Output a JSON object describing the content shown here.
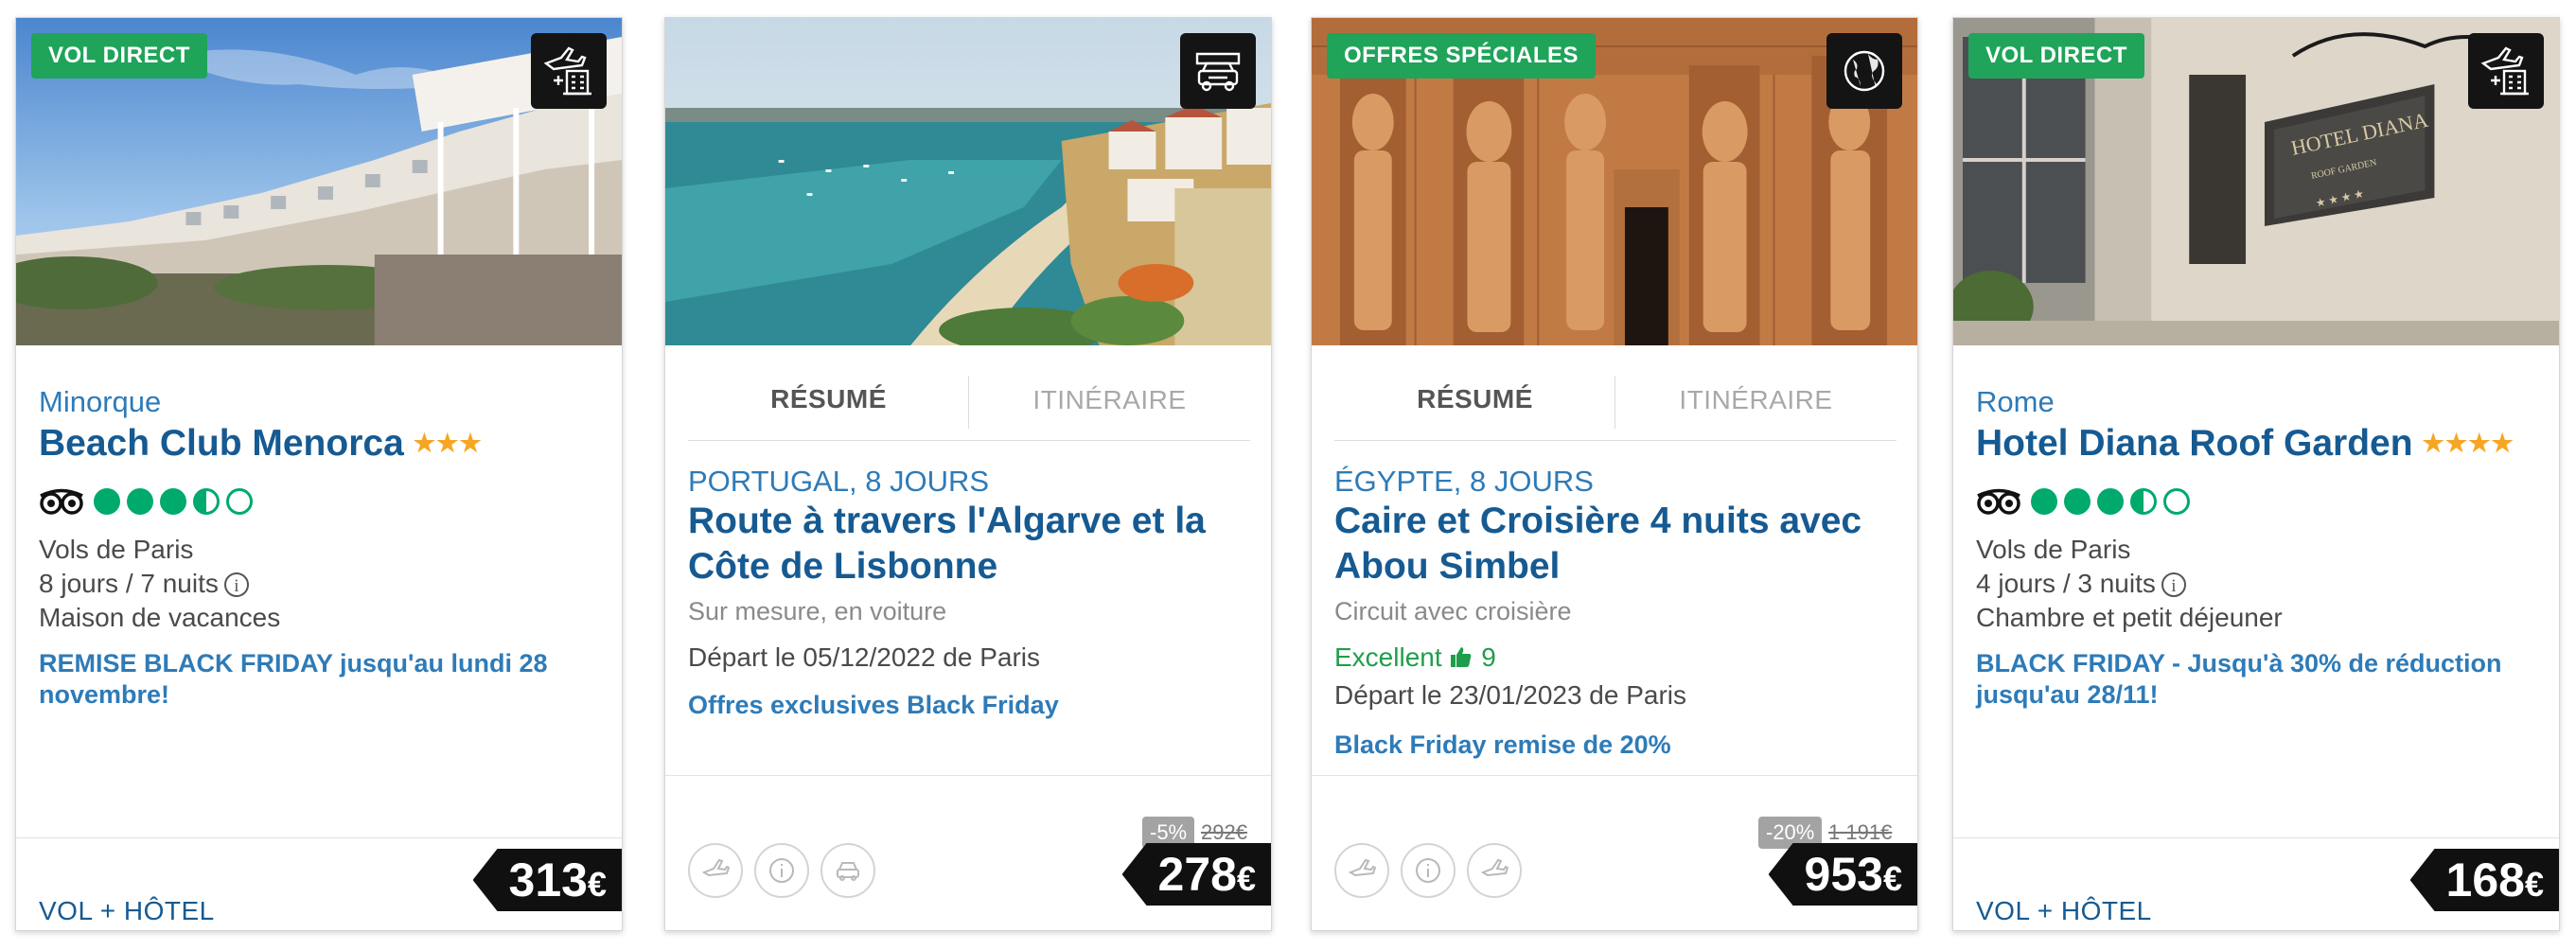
{
  "cards": [
    {
      "badge": "VOL DIRECT",
      "type_icon": "plane-hotel-icon",
      "destination": "Minorque",
      "name": "Beach Club Menorca",
      "stars": "★★★",
      "tripadvisor_rating": 3.5,
      "lines": [
        "Vols de Paris",
        "8 jours / 7 nuits",
        "Maison de vacances"
      ],
      "promo": "REMISE BLACK FRIDAY jusqu'au lundi 28 novembre!",
      "footer_label": "VOL + HÔTEL",
      "price": "313",
      "currency": "€"
    },
    {
      "type_icon": "car-icon",
      "tabs": [
        "RÉSUMÉ",
        "ITINÉRAIRE"
      ],
      "destination": "PORTUGAL, 8 JOURS",
      "title": "Route à travers l'Algarve et la Côte de Lisbonne",
      "subtitle": "Sur mesure, en voiture",
      "departure": "Départ le 05/12/2022 de Paris",
      "promo": "Offres exclusives Black Friday",
      "transport_icons": [
        "plane-icon",
        "info-icon",
        "car-icon"
      ],
      "discount": "-5%",
      "old_price": "292€",
      "price": "278",
      "currency": "€"
    },
    {
      "badge": "OFFRES SPÉCIALES",
      "type_icon": "globe-icon",
      "tabs": [
        "RÉSUMÉ",
        "ITINÉRAIRE"
      ],
      "destination": "ÉGYPTE, 8 JOURS",
      "title": "Caire et Croisière 4 nuits avec Abou Simbel",
      "subtitle": "Circuit avec croisière",
      "review_label": "Excellent",
      "review_score": "9",
      "departure": "Départ le 23/01/2023 de Paris",
      "promo": "Black Friday remise de 20%",
      "transport_icons": [
        "plane-icon",
        "info-icon",
        "plane-icon"
      ],
      "discount": "-20%",
      "old_price": "1 191€",
      "price": "953",
      "currency": "€"
    },
    {
      "badge": "VOL DIRECT",
      "type_icon": "plane-hotel-icon",
      "destination": "Rome",
      "name": "Hotel Diana Roof Garden",
      "stars": "★★★★",
      "tripadvisor_rating": 3.5,
      "lines": [
        "Vols de Paris",
        "4 jours / 3 nuits",
        "Chambre et petit déjeuner"
      ],
      "promo": "BLACK FRIDAY - Jusqu'à 30% de réduction jusqu'au 28/11!",
      "footer_label": "VOL + HÔTEL",
      "price": "168",
      "currency": "€"
    }
  ]
}
